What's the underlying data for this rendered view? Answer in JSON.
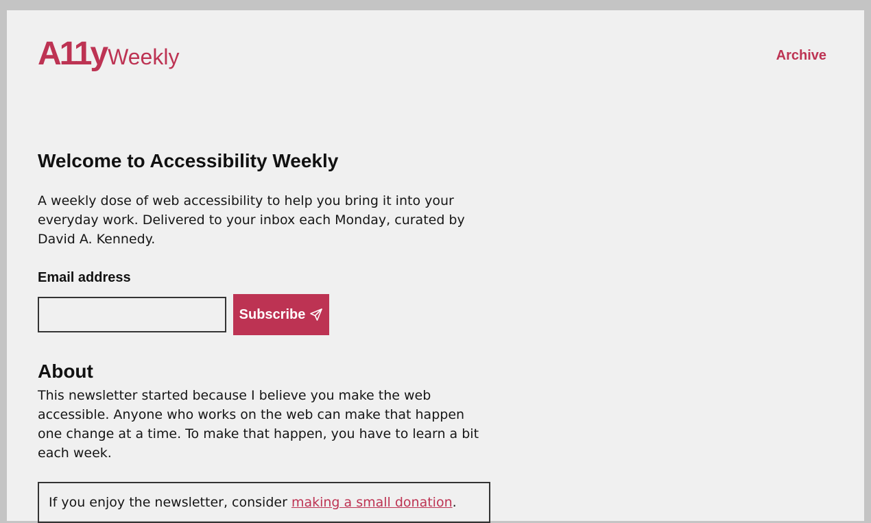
{
  "header": {
    "logo_bold": "A11y",
    "logo_light": "Weekly",
    "nav_archive": "Archive"
  },
  "main": {
    "title": "Welcome to Accessibility Weekly",
    "intro": "A weekly dose of web accessibility to help you bring it into your everyday work. Delivered to your inbox each Monday, curated by David A. Kennedy.",
    "email_label": "Email address",
    "email_value": "",
    "subscribe_label": "Subscribe",
    "subscribe_icon": "send-icon"
  },
  "about": {
    "heading": "About",
    "text": "This newsletter started because I believe you make the web accessible. Anyone who works on the web can make that happen one change at a time. To make that happen, you have to learn a bit each week."
  },
  "donation": {
    "prefix": "If you enjoy the newsletter, consider ",
    "link": "making a small donation",
    "suffix": "."
  },
  "colors": {
    "accent": "#bd3353",
    "background": "#f0f0f0",
    "outer": "#c4c4c4",
    "text": "#151515"
  }
}
